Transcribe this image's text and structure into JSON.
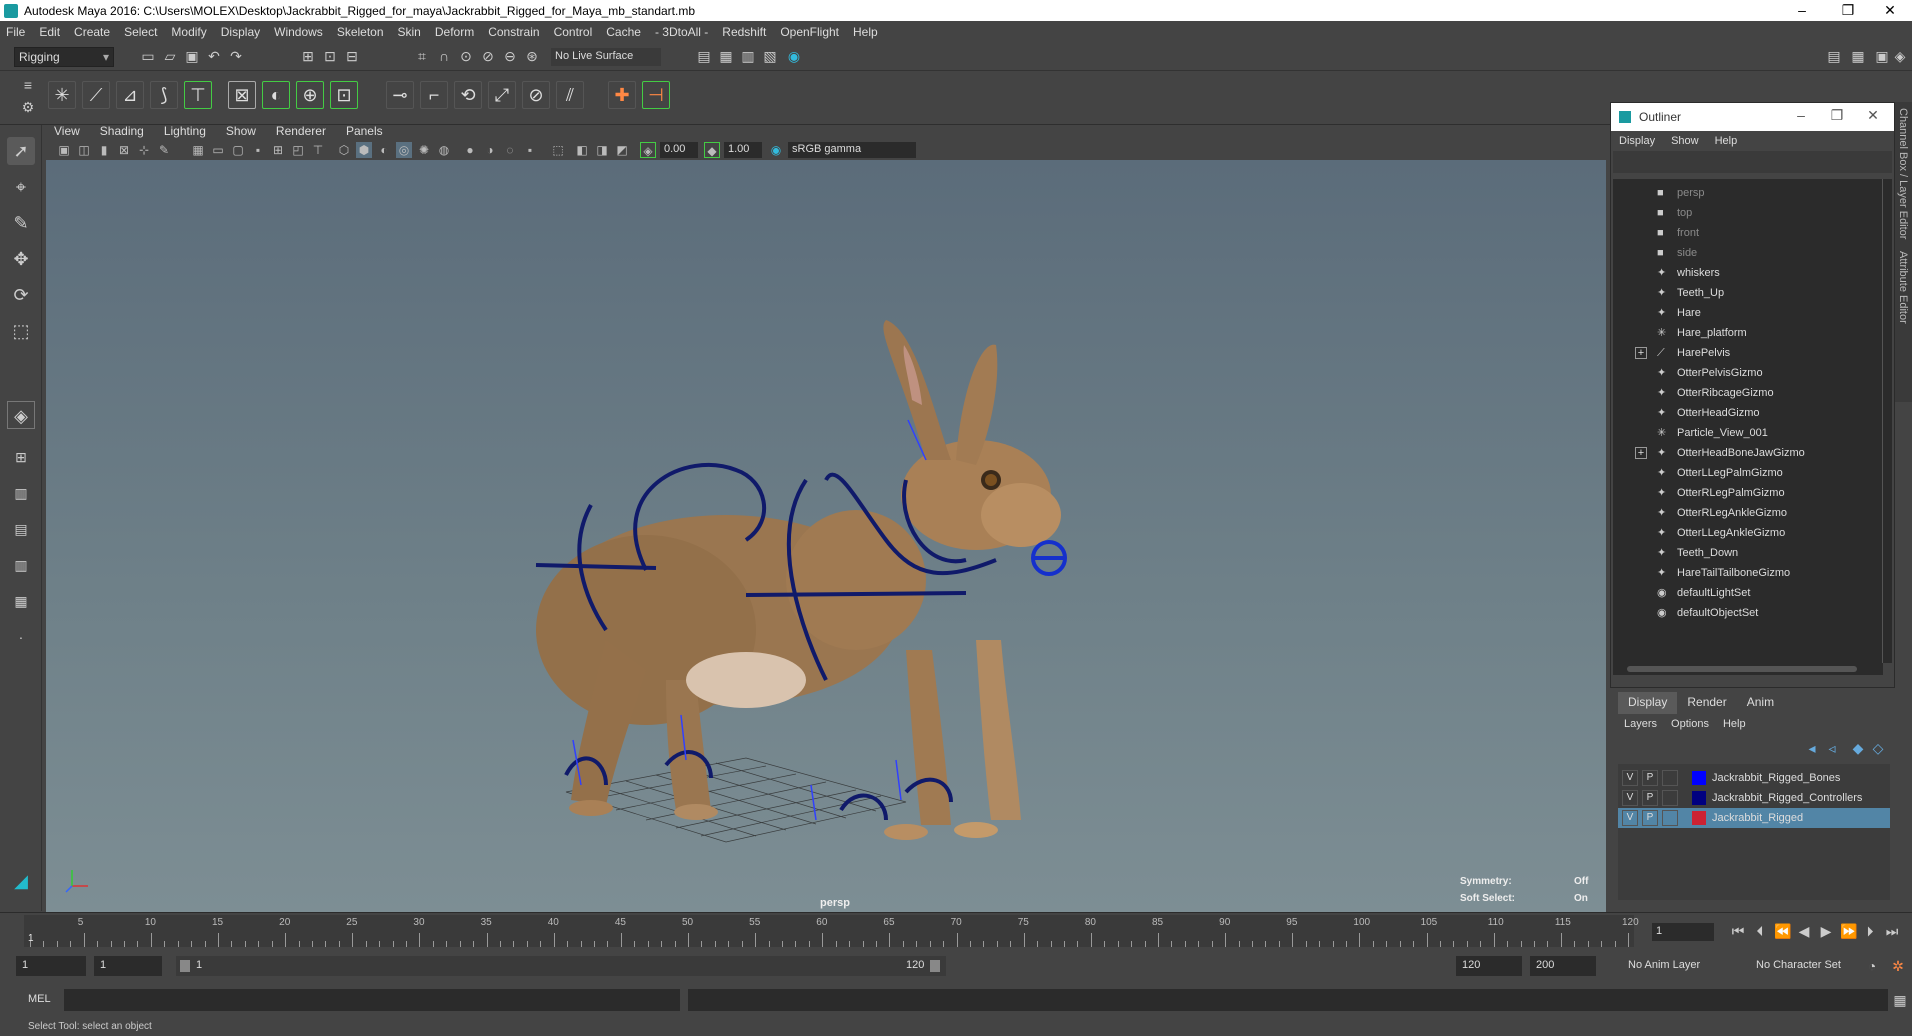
{
  "window": {
    "title": "Autodesk Maya 2016: C:\\Users\\MOLEX\\Desktop\\Jackrabbit_Rigged_for_maya\\Jackrabbit_Rigged_for_Maya_mb_standart.mb",
    "minimize": "–",
    "restore": "❐",
    "close": "✕"
  },
  "menubar": [
    "File",
    "Edit",
    "Create",
    "Select",
    "Modify",
    "Display",
    "Windows",
    "Skeleton",
    "Skin",
    "Deform",
    "Constrain",
    "Control",
    "Cache",
    "- 3DtoAll -",
    "Redshift",
    "OpenFlight",
    "Help"
  ],
  "toolbar": {
    "mode": "Rigging",
    "live_surface": "No Live Surface"
  },
  "viewport": {
    "menu": [
      "View",
      "Shading",
      "Lighting",
      "Show",
      "Renderer",
      "Panels"
    ],
    "near_value": "0.00",
    "far_value": "1.00",
    "color_space": "sRGB gamma",
    "camera_label": "persp",
    "symmetry_label": "Symmetry:",
    "symmetry_value": "Off",
    "soft_select_label": "Soft Select:",
    "soft_select_value": "On"
  },
  "outliner": {
    "title": "Outliner",
    "menu": [
      "Display",
      "Show",
      "Help"
    ],
    "items": [
      {
        "label": "persp",
        "icon": "camera-icon",
        "dim": true,
        "expand": false
      },
      {
        "label": "top",
        "icon": "camera-icon",
        "dim": true,
        "expand": false
      },
      {
        "label": "front",
        "icon": "camera-icon",
        "dim": true,
        "expand": false
      },
      {
        "label": "side",
        "icon": "camera-icon",
        "dim": true,
        "expand": false
      },
      {
        "label": "whiskers",
        "icon": "mesh-icon",
        "dim": false,
        "expand": false
      },
      {
        "label": "Teeth_Up",
        "icon": "mesh-icon",
        "dim": false,
        "expand": false
      },
      {
        "label": "Hare",
        "icon": "mesh-icon",
        "dim": false,
        "expand": false
      },
      {
        "label": "Hare_platform",
        "icon": "locator-icon",
        "dim": false,
        "expand": false
      },
      {
        "label": "HarePelvis",
        "icon": "joint-icon",
        "dim": false,
        "expand": true
      },
      {
        "label": "OtterPelvisGizmo",
        "icon": "mesh-icon",
        "dim": false,
        "expand": false
      },
      {
        "label": "OtterRibcageGizmo",
        "icon": "mesh-icon",
        "dim": false,
        "expand": false
      },
      {
        "label": "OtterHeadGizmo",
        "icon": "mesh-icon",
        "dim": false,
        "expand": false
      },
      {
        "label": "Particle_View_001",
        "icon": "locator-icon",
        "dim": false,
        "expand": false
      },
      {
        "label": "OtterHeadBoneJawGizmo",
        "icon": "mesh-icon",
        "dim": false,
        "expand": true
      },
      {
        "label": "OtterLLegPalmGizmo",
        "icon": "mesh-icon",
        "dim": false,
        "expand": false
      },
      {
        "label": "OtterRLegPalmGizmo",
        "icon": "mesh-icon",
        "dim": false,
        "expand": false
      },
      {
        "label": "OtterRLegAnkleGizmo",
        "icon": "mesh-icon",
        "dim": false,
        "expand": false
      },
      {
        "label": "OtterLLegAnkleGizmo",
        "icon": "mesh-icon",
        "dim": false,
        "expand": false
      },
      {
        "label": "Teeth_Down",
        "icon": "mesh-icon",
        "dim": false,
        "expand": false
      },
      {
        "label": "HareTailTailboneGizmo",
        "icon": "mesh-icon",
        "dim": false,
        "expand": false
      },
      {
        "label": "defaultLightSet",
        "icon": "set-icon",
        "dim": false,
        "expand": false
      },
      {
        "label": "defaultObjectSet",
        "icon": "set-icon",
        "dim": false,
        "expand": false
      }
    ]
  },
  "side_tabs": [
    "Channel Box / Layer Editor",
    "Attribute Editor"
  ],
  "layers": {
    "tabs": [
      "Display",
      "Render",
      "Anim"
    ],
    "menu": [
      "Layers",
      "Options",
      "Help"
    ],
    "rows": [
      {
        "v": "V",
        "p": "P",
        "name": "Jackrabbit_Rigged_Bones",
        "color": "#0000ff",
        "selected": false
      },
      {
        "v": "V",
        "p": "P",
        "name": "Jackrabbit_Rigged_Controllers",
        "color": "#000080",
        "selected": false
      },
      {
        "v": "V",
        "p": "P",
        "name": "Jackrabbit_Rigged",
        "color": "#cc2233",
        "selected": true
      }
    ]
  },
  "timeline": {
    "ticks": [
      "5",
      "10",
      "15",
      "20",
      "25",
      "30",
      "35",
      "40",
      "45",
      "50",
      "55",
      "60",
      "65",
      "70",
      "75",
      "80",
      "85",
      "90",
      "95",
      "100",
      "105",
      "110",
      "115",
      "120"
    ],
    "start_label": "1",
    "current_frame": "1"
  },
  "range": {
    "start": "1",
    "playback_start": "1",
    "slider_start": "1",
    "slider_end": "120",
    "playback_end": "120",
    "end": "200",
    "anim_layer": "No Anim Layer",
    "character_set": "No Character Set"
  },
  "command": {
    "language": "MEL"
  },
  "status": {
    "help_line": "Select Tool: select an object"
  }
}
